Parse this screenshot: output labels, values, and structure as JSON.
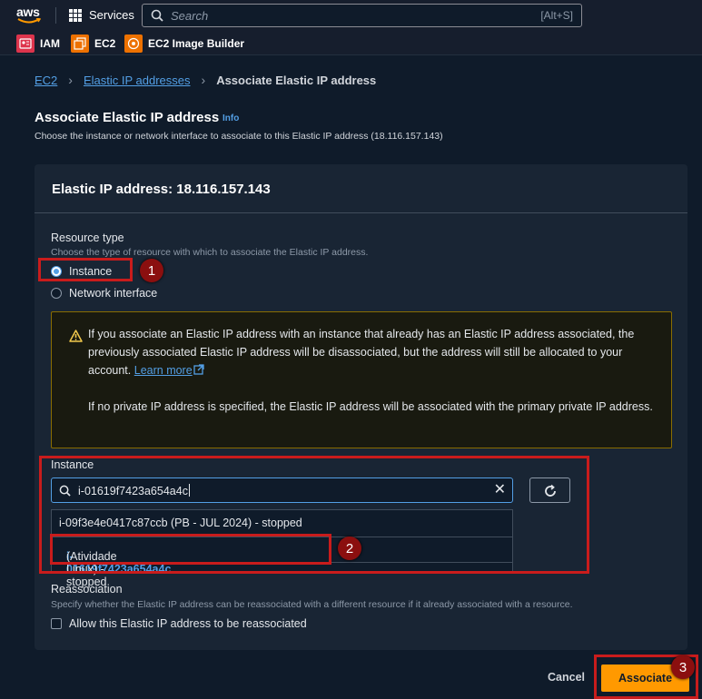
{
  "topnav": {
    "logo_text": "aws",
    "services_label": "Services",
    "search_placeholder": "Search",
    "search_shortcut": "[Alt+S]"
  },
  "favorites": [
    {
      "label": "IAM",
      "icon": "iam-icon",
      "color": "#dd344c"
    },
    {
      "label": "EC2",
      "icon": "ec2-icon",
      "color": "#ed7100"
    },
    {
      "label": "EC2 Image Builder",
      "icon": "image-builder-icon",
      "color": "#ed7100"
    }
  ],
  "breadcrumb": {
    "items": [
      "EC2",
      "Elastic IP addresses"
    ],
    "current": "Associate Elastic IP address"
  },
  "page": {
    "title": "Associate Elastic IP address",
    "info": "Info",
    "description": "Choose the instance or network interface to associate to this Elastic IP address (18.116.157.143)"
  },
  "panel": {
    "title": "Elastic IP address: 18.116.157.143",
    "resource_type": {
      "label": "Resource type",
      "description": "Choose the type of resource with which to associate the Elastic IP address.",
      "options": [
        {
          "label": "Instance",
          "selected": true
        },
        {
          "label": "Network interface",
          "selected": false
        }
      ]
    },
    "warning": {
      "text1": "If you associate an Elastic IP address with an instance that already has an Elastic IP address associated, the previously associated Elastic IP address will be disassociated, but the address will still be allocated to your account.",
      "link": "Learn more",
      "text2": "If no private IP address is specified, the Elastic IP address will be associated with the primary private IP address."
    },
    "instance": {
      "label": "Instance",
      "value": "i-01619f7423a654a4c",
      "options": [
        {
          "text": "i-09f3e4e0417c87ccb (PB - JUL 2024) - stopped"
        },
        {
          "match": "i-01619f7423a654a4c",
          "rest": " (Atividade Linux) - stopped"
        }
      ]
    },
    "reassociation": {
      "label": "Reassociation",
      "description": "Specify whether the Elastic IP address can be reassociated with a different resource if it already associated with a resource.",
      "checkbox_label": "Allow this Elastic IP address to be reassociated",
      "checked": false
    }
  },
  "actions": {
    "cancel": "Cancel",
    "associate": "Associate"
  },
  "annotations": [
    "1",
    "2",
    "3"
  ],
  "colors": {
    "accent": "#539fe5",
    "primary_button": "#ff9900",
    "warning_border": "#8a6d00",
    "annotation": "#c91c1c"
  }
}
